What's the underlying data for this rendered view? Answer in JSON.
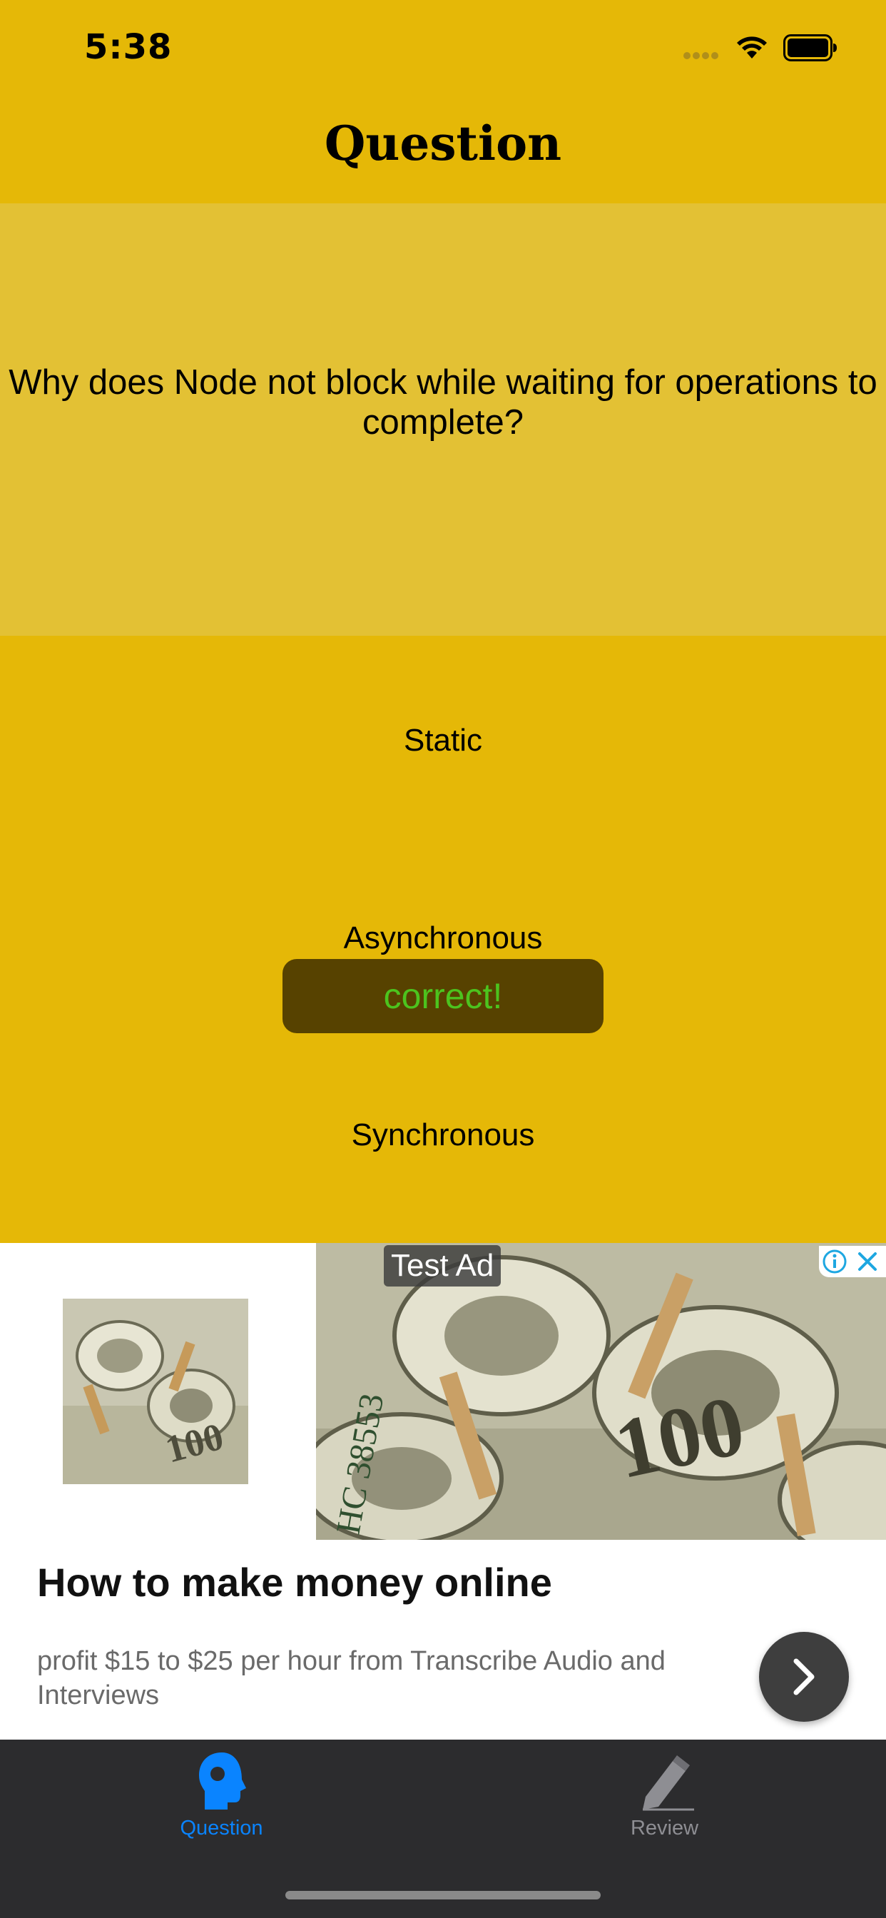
{
  "status_bar": {
    "time": "5:38"
  },
  "nav": {
    "title": "Question"
  },
  "question": {
    "text": "Why does Node not block while waiting for operations to complete?"
  },
  "answers": [
    "Static",
    "Asynchronous",
    "Synchronous"
  ],
  "toast": {
    "text": "correct!",
    "text_color": "#4CC31E",
    "background": "#574200"
  },
  "ad": {
    "label": "Test Ad",
    "headline": "How to make money online",
    "body": "profit $15 to $25 per hour from Transcribe Audio and Interviews",
    "info_icon": "info-icon",
    "close_icon": "close-icon",
    "cta_icon": "chevron-right-icon"
  },
  "tabs": [
    {
      "label": "Question",
      "icon": "head-icon",
      "active": true
    },
    {
      "label": "Review",
      "icon": "pen-icon",
      "active": false
    }
  ],
  "colors": {
    "background": "#E5B807",
    "question_panel": "#E3C134",
    "tab_bar": "#2C2C2E",
    "tab_active": "#0A84FF",
    "tab_inactive": "#8E8E93"
  }
}
